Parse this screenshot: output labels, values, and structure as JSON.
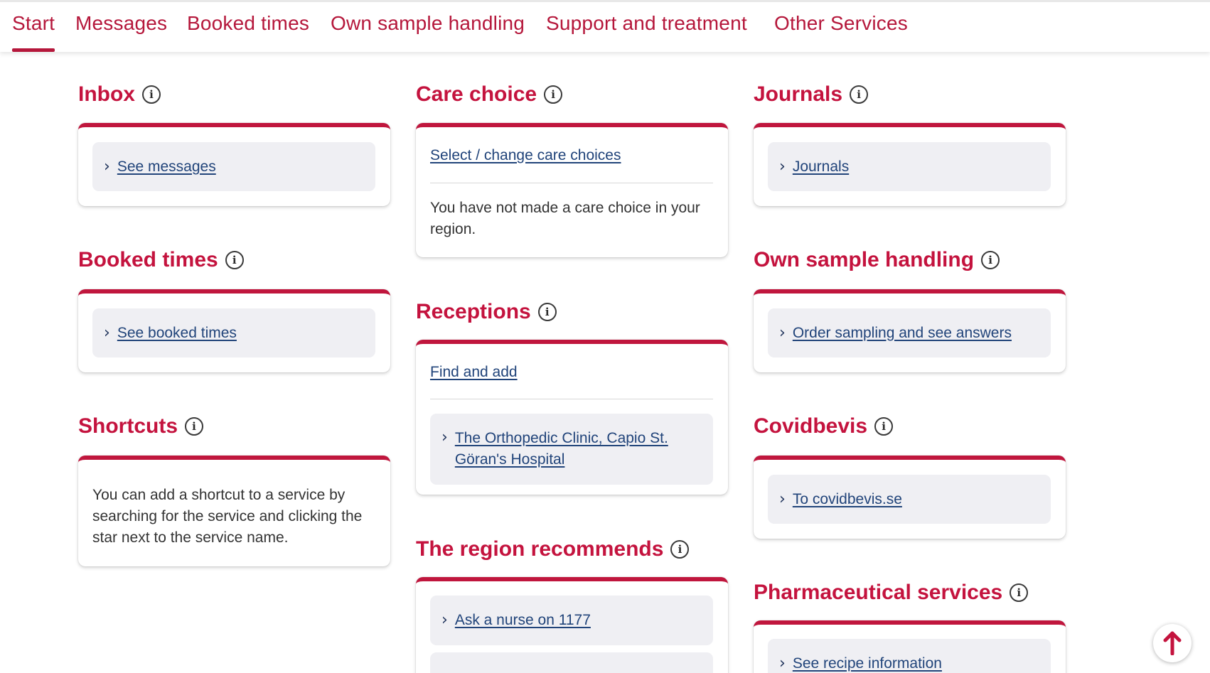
{
  "nav": {
    "tabs": [
      {
        "label": "Start"
      },
      {
        "label": "Messages"
      },
      {
        "label": "Booked times"
      },
      {
        "label": "Own sample handling"
      },
      {
        "label": "Support and treatment"
      },
      {
        "label": "Other Services"
      }
    ]
  },
  "inbox": {
    "title": "Inbox",
    "link": "See messages"
  },
  "booked_times": {
    "title": "Booked times",
    "link": "See booked times"
  },
  "shortcuts": {
    "title": "Shortcuts",
    "text": "You can add a shortcut to a service by searching for the service and clicking the star next to the service name."
  },
  "care_choice": {
    "title": "Care choice",
    "link": "Select / change care choices",
    "text": "You have not made a care choice in your region."
  },
  "receptions": {
    "title": "Receptions",
    "find_link": "Find and add",
    "item": "The Orthopedic Clinic, Capio St. Göran's Hospital"
  },
  "region_recommends": {
    "title": "The region recommends",
    "link": "Ask a nurse on 1177"
  },
  "journals": {
    "title": "Journals",
    "link": "Journals"
  },
  "own_sample": {
    "title": "Own sample handling",
    "link": "Order sampling and see answers"
  },
  "covidbevis": {
    "title": "Covidbevis",
    "link": "To covidbevis.se"
  },
  "pharma": {
    "title": "Pharmaceutical services",
    "link": "See recipe information"
  },
  "icons": {
    "info": "i",
    "chevron": "›",
    "back_to_top": "arrow-up-icon"
  },
  "colors": {
    "brand": "#c4133e",
    "link": "#21447a",
    "link_box": "#efeff3"
  }
}
